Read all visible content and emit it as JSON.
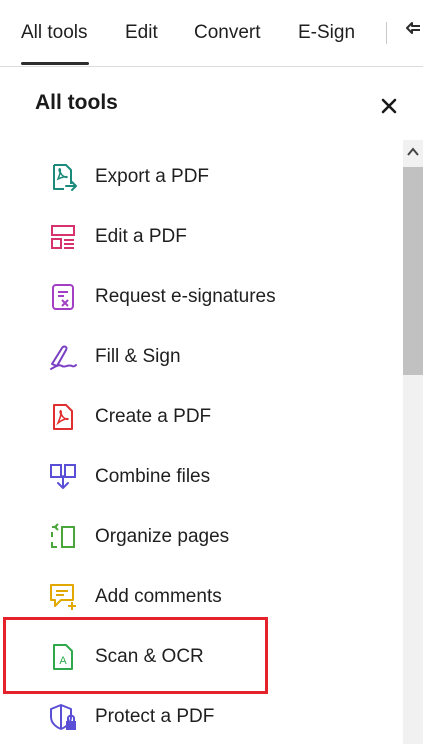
{
  "tabs": [
    {
      "label": "All tools",
      "active": true
    },
    {
      "label": "Edit"
    },
    {
      "label": "Convert"
    },
    {
      "label": "E-Sign"
    }
  ],
  "panel": {
    "title": "All tools",
    "close_icon": "close-icon"
  },
  "tools": [
    {
      "label": "Export a PDF",
      "icon": "export-pdf-icon",
      "color": "#1a8a7a"
    },
    {
      "label": "Edit a PDF",
      "icon": "edit-pdf-icon",
      "color": "#d6326e"
    },
    {
      "label": "Request e-signatures",
      "icon": "request-signatures-icon",
      "color": "#a23fc4"
    },
    {
      "label": "Fill & Sign",
      "icon": "fill-sign-icon",
      "color": "#7a3fc4"
    },
    {
      "label": "Create a PDF",
      "icon": "create-pdf-icon",
      "color": "#e02f2f"
    },
    {
      "label": "Combine files",
      "icon": "combine-files-icon",
      "color": "#5b4fd6"
    },
    {
      "label": "Organize pages",
      "icon": "organize-pages-icon",
      "color": "#4aa63a"
    },
    {
      "label": "Add comments",
      "icon": "add-comments-icon",
      "color": "#e0a800"
    },
    {
      "label": "Scan & OCR",
      "icon": "scan-ocr-icon",
      "color": "#2ea84a",
      "highlighted": true
    },
    {
      "label": "Protect a PDF",
      "icon": "protect-pdf-icon",
      "color": "#5b4fd6"
    }
  ],
  "highlight_color": "#e3222b"
}
